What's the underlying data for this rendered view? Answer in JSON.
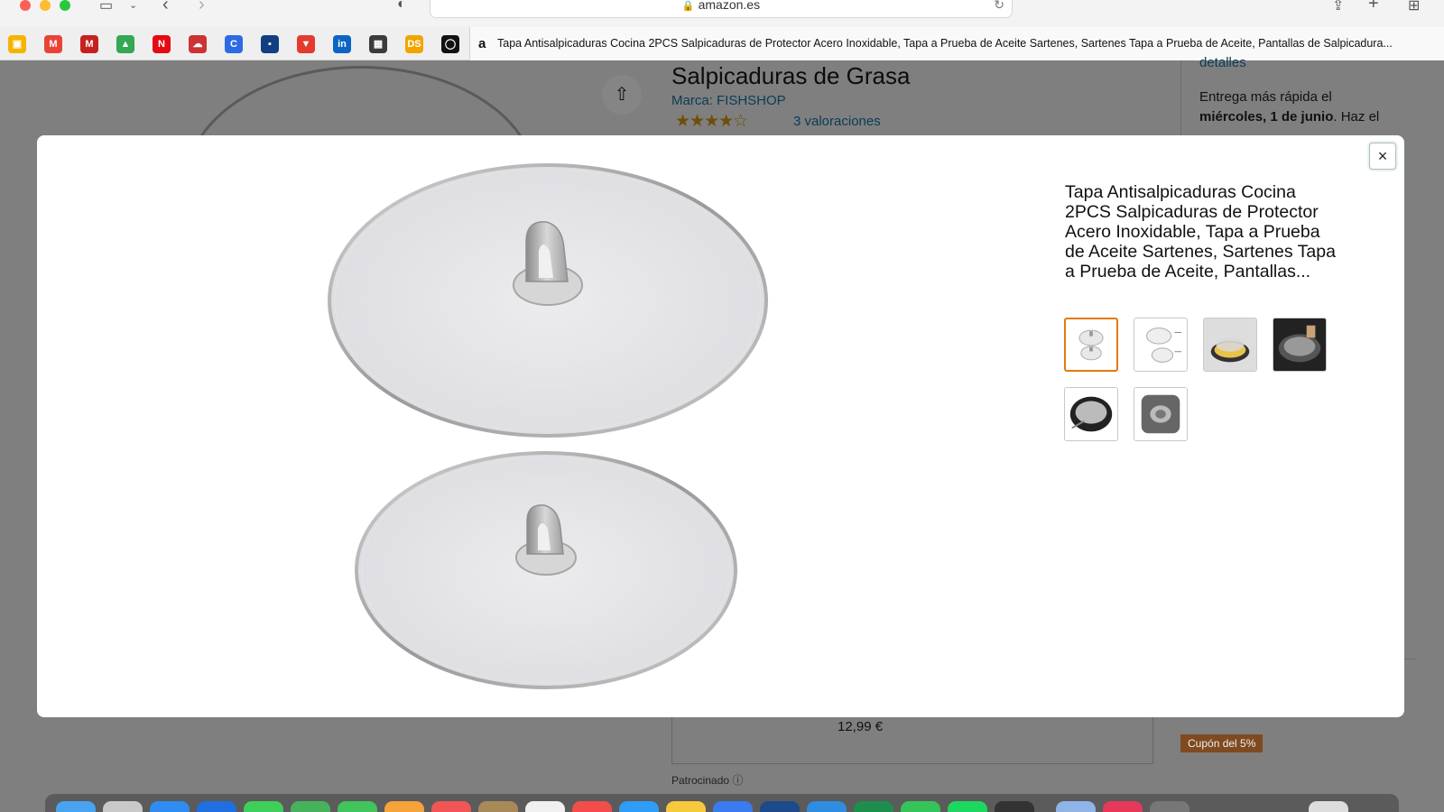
{
  "browser": {
    "url": "amazon.es",
    "tab_title": "Tapa Antisalpicaduras Cocina 2PCS Salpicaduras de Protector Acero Inoxidable, Tapa a Prueba de Aceite Sartenes, Sartenes Tapa a Prueba de Aceite, Pantallas de Salpicadura...",
    "favorites": [
      {
        "icon": "classroom-icon",
        "color": "#f4b400",
        "glyph": "▣"
      },
      {
        "icon": "gmail-icon",
        "color": "#ea4335",
        "glyph": "M"
      },
      {
        "icon": "gmail-icon",
        "color": "#c5221f",
        "glyph": "M"
      },
      {
        "icon": "drive-icon",
        "color": "#34a853",
        "glyph": "▲"
      },
      {
        "icon": "netflix-icon",
        "color": "#e50914",
        "glyph": "N"
      },
      {
        "icon": "cloud-icon",
        "color": "#c33",
        "glyph": "☁"
      },
      {
        "icon": "c-app-icon",
        "color": "#2d6be4",
        "glyph": "C"
      },
      {
        "icon": "bank-icon",
        "color": "#123f82",
        "glyph": "▪"
      },
      {
        "icon": "red-app-icon",
        "color": "#e33b2e",
        "glyph": "▼"
      },
      {
        "icon": "linkedin-icon",
        "color": "#0a66c2",
        "glyph": "in"
      },
      {
        "icon": "grid-app-icon",
        "color": "#3b3b3b",
        "glyph": "▦"
      },
      {
        "icon": "ds-icon",
        "color": "#f0a500",
        "glyph": "DS"
      },
      {
        "icon": "circle-app-icon",
        "color": "#111111",
        "glyph": "◯"
      }
    ]
  },
  "page": {
    "title": "Salpicaduras de Grasa",
    "brand": "Marca: FISHSHOP",
    "stars": "★★★★☆",
    "ratings": "3 valoraciones",
    "details_link": "detalles",
    "delivery_1": "Entrega más rápida el",
    "delivery_date": "miércoles, 1 de junio",
    "delivery_2": ". Haz el",
    "price": "12,99 €",
    "sponsored": "Patrocinado",
    "coupon": "Cupón del 5%"
  },
  "modal": {
    "title": "Tapa Antisalpicaduras Cocina 2PCS Salpicaduras de Protector Acero Inoxidable, Tapa a Prueba de Aceite Sartenes, Sartenes Tapa a Prueba de Aceite, Pantallas...",
    "close_label": "×",
    "thumbnails": [
      {
        "name": "thumb-1",
        "kind": "two-screens",
        "selected": true
      },
      {
        "name": "thumb-2",
        "kind": "two-screens-dims",
        "selected": false
      },
      {
        "name": "thumb-3",
        "kind": "pan-yellow",
        "selected": false
      },
      {
        "name": "thumb-4",
        "kind": "pan-dark",
        "selected": false
      },
      {
        "name": "thumb-5",
        "kind": "pan-dark-2",
        "selected": false
      },
      {
        "name": "thumb-6",
        "kind": "screen-grey",
        "selected": false
      }
    ]
  },
  "colors": {
    "accent_selected": "#e47911",
    "link": "#007185",
    "overlay": "#7f7f7f"
  }
}
